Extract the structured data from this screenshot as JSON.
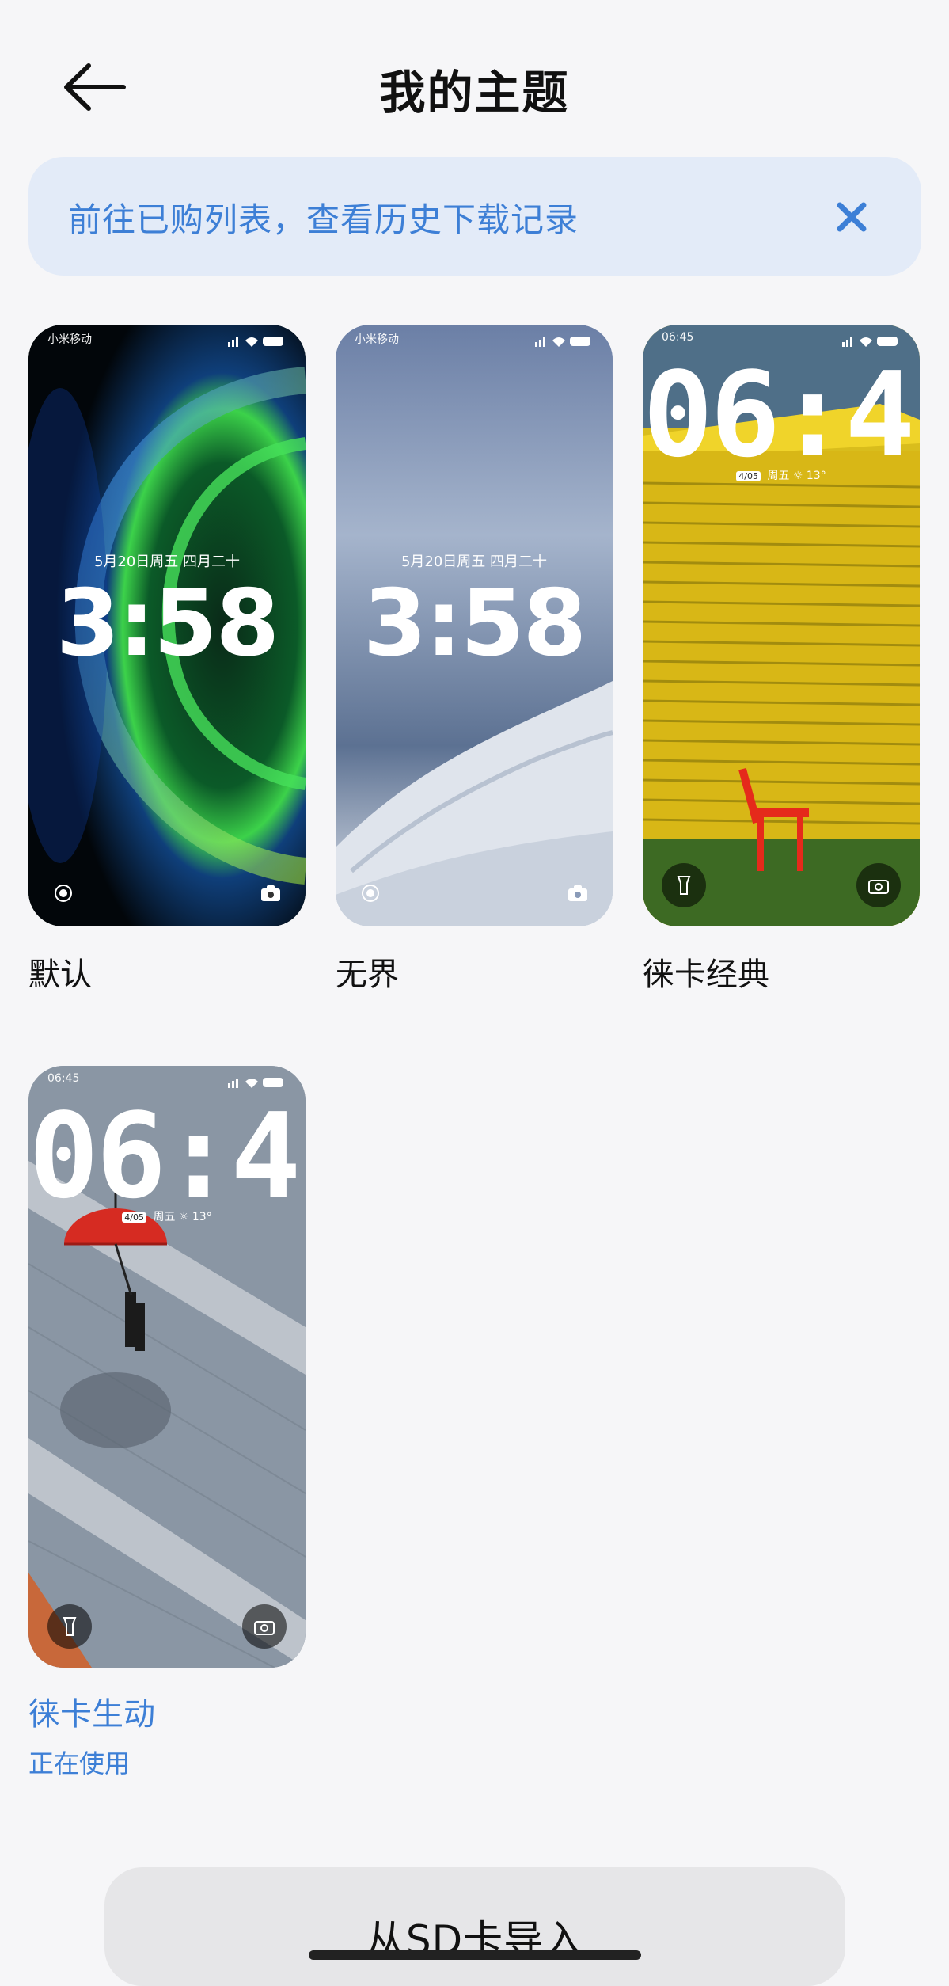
{
  "header": {
    "title": "我的主题"
  },
  "banner": {
    "text": "前往已购列表，查看历史下载记录"
  },
  "themes": [
    {
      "label": "默认",
      "preview": {
        "carrier": "小米移动",
        "battery": "100",
        "date": "5月20日周五 四月二十",
        "time": "3:58"
      }
    },
    {
      "label": "无界",
      "preview": {
        "carrier": "小米移动",
        "battery": "100",
        "date": "5月20日周五 四月二十",
        "time": "3:58"
      }
    },
    {
      "label": "徕卡经典",
      "preview": {
        "carrier": "06:45",
        "battery": "100",
        "time": "06:45",
        "date_pill": "4/05",
        "weekday": "周五",
        "weather": "☼ 13°"
      }
    },
    {
      "label": "徕卡生动",
      "status": "正在使用",
      "preview": {
        "carrier": "06:45",
        "battery": "100",
        "time": "06:45",
        "date_pill": "4/05",
        "weekday": "周五",
        "weather": "☼ 13°"
      }
    }
  ],
  "import_button": {
    "label": "从SD卡导入"
  },
  "colors": {
    "accent": "#3d7fd6",
    "banner_bg": "#e3ebf8",
    "page_bg": "#f6f6f8"
  }
}
